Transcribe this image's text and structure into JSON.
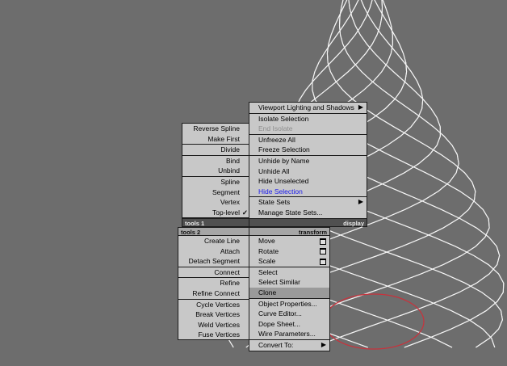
{
  "quad_labels": {
    "top_left": "tools 1",
    "top_right": "display",
    "bottom_left": "tools 2",
    "bottom_right": "transform"
  },
  "display_menu": [
    {
      "label": "Viewport Lighting and Shadows",
      "submenu": true
    },
    {
      "label": "Isolate Selection"
    },
    {
      "label": "End Isolate",
      "disabled": true
    },
    {
      "label": "Unfreeze All"
    },
    {
      "label": "Freeze Selection"
    },
    {
      "label": "Unhide by Name"
    },
    {
      "label": "Unhide All"
    },
    {
      "label": "Hide Unselected"
    },
    {
      "label": "Hide Selection",
      "highlight_text": true
    },
    {
      "label": "State Sets",
      "submenu": true
    },
    {
      "label": "Manage State Sets..."
    }
  ],
  "tools1_menu": [
    {
      "label": "Reverse Spline"
    },
    {
      "label": "Make First"
    },
    {
      "label": "Divide"
    },
    {
      "label": "Bind"
    },
    {
      "label": "Unbind"
    },
    {
      "label": "Spline"
    },
    {
      "label": "Segment"
    },
    {
      "label": "Vertex"
    },
    {
      "label": "Top-level",
      "checked": true
    }
  ],
  "tools2_menu": [
    {
      "label": "Create Line"
    },
    {
      "label": "Attach"
    },
    {
      "label": "Detach Segment"
    },
    {
      "label": "Connect"
    },
    {
      "label": "Refine"
    },
    {
      "label": "Refine Connect"
    },
    {
      "label": "Cycle Vertices"
    },
    {
      "label": "Break Vertices"
    },
    {
      "label": "Weld Vertices"
    },
    {
      "label": "Fuse Vertices"
    }
  ],
  "transform_menu": [
    {
      "label": "Move",
      "settings_box": true
    },
    {
      "label": "Rotate",
      "settings_box": true
    },
    {
      "label": "Scale",
      "settings_box": true
    },
    {
      "label": "Select"
    },
    {
      "label": "Select Similar"
    },
    {
      "label": "Clone",
      "hovered": true
    },
    {
      "label": "Object Properties..."
    },
    {
      "label": "Curve Editor..."
    },
    {
      "label": "Dope Sheet..."
    },
    {
      "label": "Wire Parameters..."
    },
    {
      "label": "Convert To:",
      "submenu": true
    }
  ],
  "icons": {
    "submenu_arrow": "▶",
    "check": "✓"
  },
  "colors": {
    "background": "#6d6d6d",
    "menu": "#c8c8c8",
    "wireframe": "#f4f4f4",
    "selection_ring": "#c8323c",
    "blue_text": "#1a1aee",
    "hover": "#9a9a9a"
  }
}
